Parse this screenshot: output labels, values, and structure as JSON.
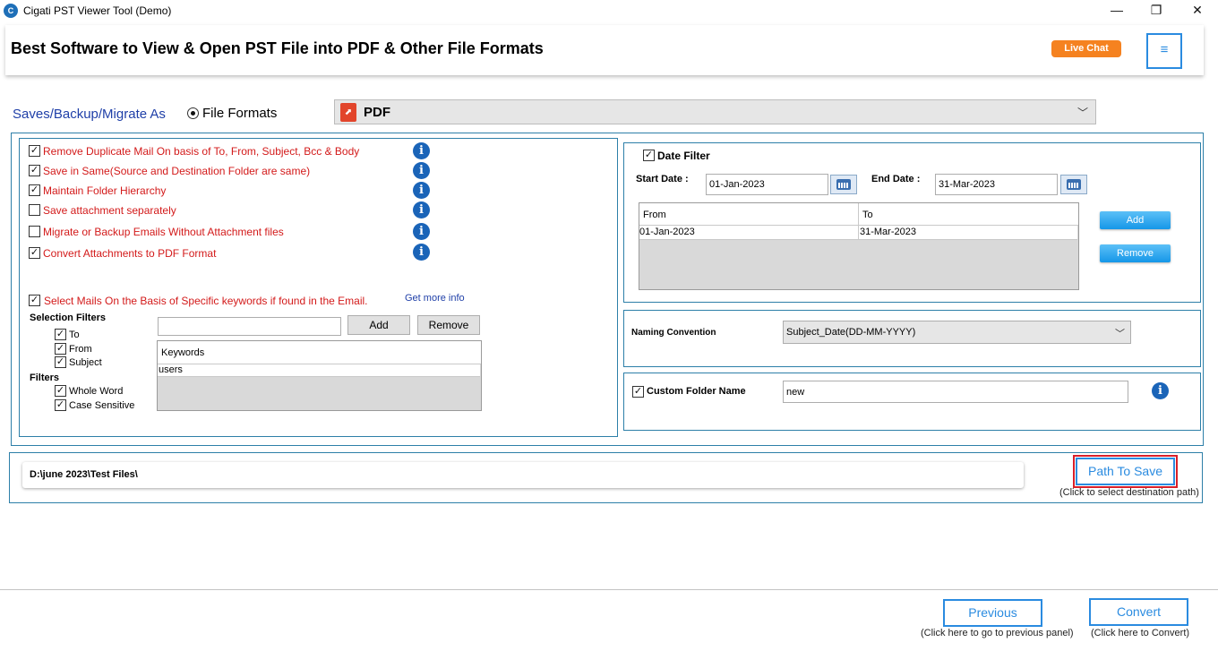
{
  "window": {
    "title": "Cigati PST Viewer Tool (Demo)",
    "icon": "cigati-logo-icon",
    "minimize": "—",
    "maximize": "❐",
    "close": "✕"
  },
  "header": {
    "title": "Best Software to View & Open PST File into PDF & Other File Formats",
    "live_chat": "Live Chat",
    "menu_icon": "≡"
  },
  "saves": {
    "label": "Saves/Backup/Migrate As",
    "radio_label": "File Formats",
    "format_selected": "PDF"
  },
  "options": [
    {
      "label": "Remove Duplicate Mail On basis of To, From, Subject, Bcc & Body",
      "checked": true
    },
    {
      "label": "Save in Same(Source and Destination Folder are same)",
      "checked": true
    },
    {
      "label": "Maintain Folder Hierarchy",
      "checked": true
    },
    {
      "label": "Save attachment separately",
      "checked": false
    },
    {
      "label": "Migrate or Backup Emails Without Attachment files",
      "checked": false
    },
    {
      "label": "Convert Attachments to PDF Format",
      "checked": true
    }
  ],
  "keywords": {
    "select_label": "Select Mails On the Basis of Specific keywords if found in the Email.",
    "get_more_info": "Get more info",
    "selection_filters_label": "Selection Filters",
    "selection_filters": [
      {
        "label": "To",
        "checked": true
      },
      {
        "label": "From",
        "checked": true
      },
      {
        "label": "Subject",
        "checked": true
      }
    ],
    "filters_label": "Filters",
    "filters": [
      {
        "label": "Whole Word",
        "checked": true
      },
      {
        "label": "Case Sensitive",
        "checked": true
      }
    ],
    "input_value": "",
    "add_label": "Add",
    "remove_label": "Remove",
    "table_header": "Keywords",
    "rows": [
      "users"
    ]
  },
  "date_filter": {
    "label": "Date Filter",
    "start_label": "Start Date :",
    "start_value": "01-Jan-2023",
    "end_label": "End Date :",
    "end_value": "31-Mar-2023",
    "col_from": "From",
    "col_to": "To",
    "rows": [
      {
        "from": "01-Jan-2023",
        "to": "31-Mar-2023"
      }
    ],
    "add_label": "Add",
    "remove_label": "Remove"
  },
  "naming": {
    "label": "Naming Convention",
    "value": "Subject_Date(DD-MM-YYYY)"
  },
  "custom_folder": {
    "label": "Custom Folder Name",
    "value": "new"
  },
  "path": {
    "value": "D:\\june 2023\\Test Files\\",
    "button": "Path To Save",
    "caption": "(Click to select destination path)"
  },
  "footer": {
    "previous_label": "Previous",
    "previous_caption": "(Click here to go to previous panel)",
    "convert_label": "Convert",
    "convert_caption": "(Click here to Convert)"
  },
  "colors": {
    "accent": "#2a8be0",
    "live_chat": "#f58220",
    "option_text": "#d31a1a",
    "info": "#1a64b8",
    "highlight_border": "#d9202a"
  }
}
